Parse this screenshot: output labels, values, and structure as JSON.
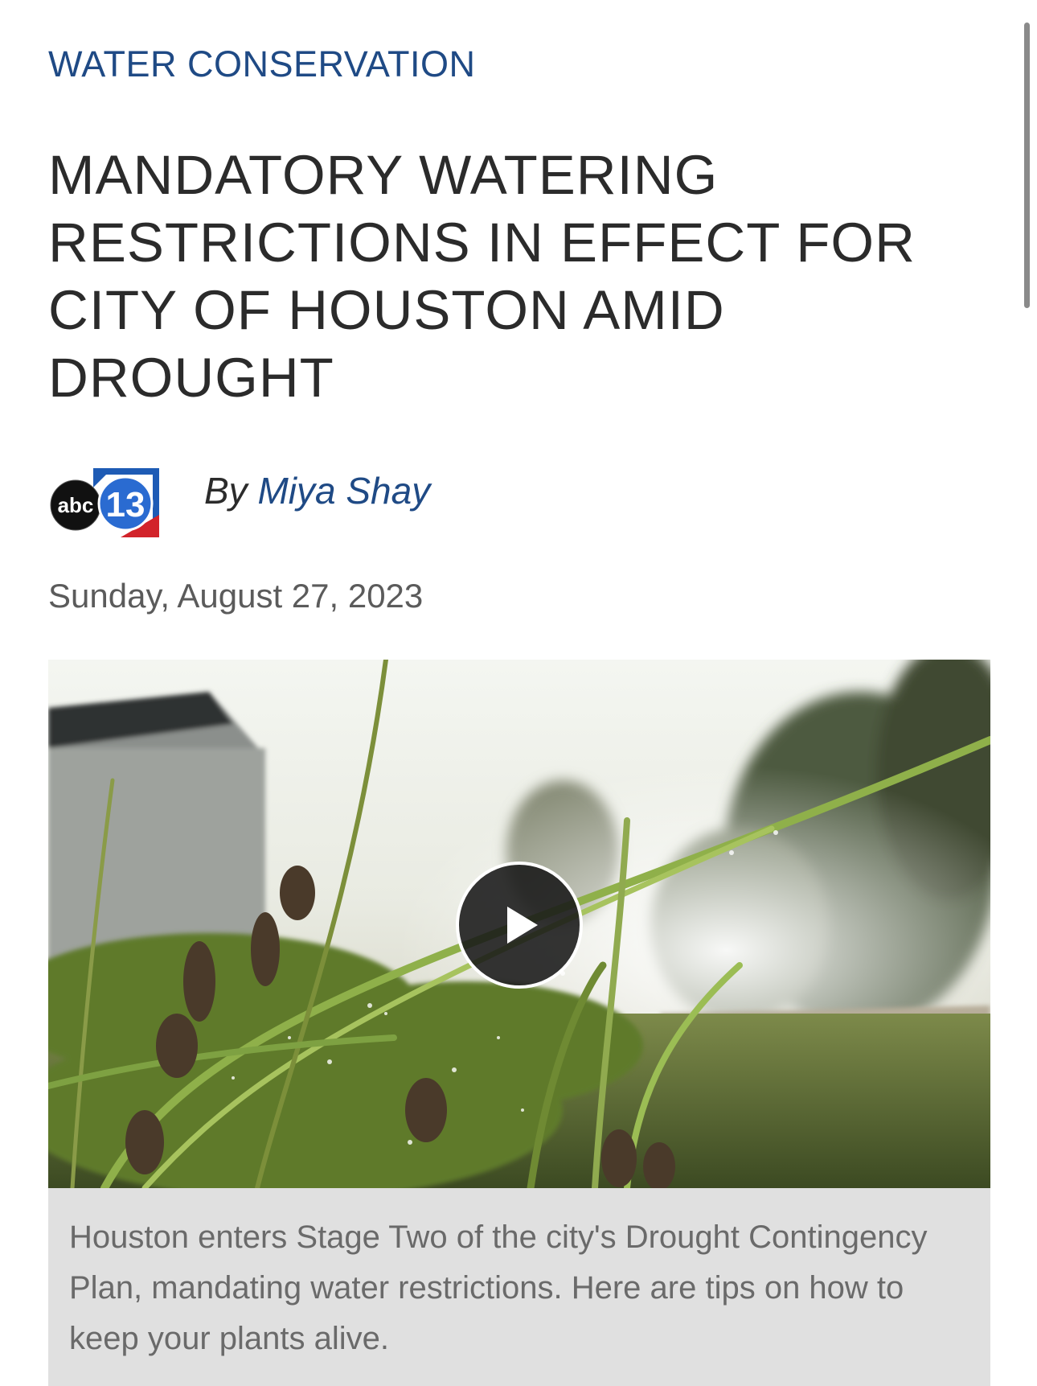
{
  "article": {
    "category": "WATER CONSERVATION",
    "headline": "MANDATORY WATERING RESTRICTIONS IN EFFECT FOR CITY OF HOUSTON AMID DROUGHT",
    "byline_prefix": "By",
    "author": "Miya Shay",
    "logo": {
      "icon": "abc13-logo",
      "text_abc": "abc",
      "text_number": "13"
    },
    "date": "Sunday, August 27, 2023"
  },
  "video": {
    "icon": "play-icon",
    "thumbnail_subject": "dew-covered grass by roadside"
  },
  "caption": {
    "text": "Houston enters Stage Two of the city's Drought Contingency Plan, mandating water restrictions. Here are tips on how to keep your plants alive."
  },
  "colors": {
    "link_blue": "#1f4a85",
    "headline": "#2b2b2b",
    "caption_bg": "#e0e0e0",
    "caption_text": "#6a6a6a",
    "date_text": "#5b5b5b"
  }
}
